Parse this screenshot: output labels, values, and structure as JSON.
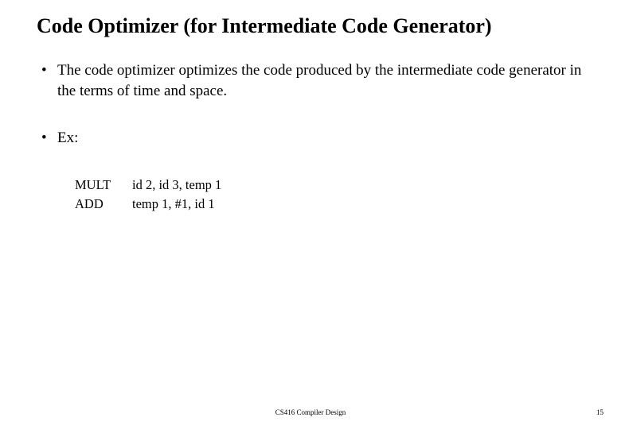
{
  "title": "Code Optimizer (for Intermediate Code Generator)",
  "bullets": [
    "The code optimizer optimizes the code produced by the intermediate code generator in the terms of time and space.",
    "Ex:"
  ],
  "code": [
    {
      "op": "MULT",
      "args": "id 2, id 3, temp 1"
    },
    {
      "op": "ADD",
      "args": "temp 1, #1, id 1"
    }
  ],
  "footer": {
    "center": "CS416 Compiler Design",
    "page": "15"
  }
}
